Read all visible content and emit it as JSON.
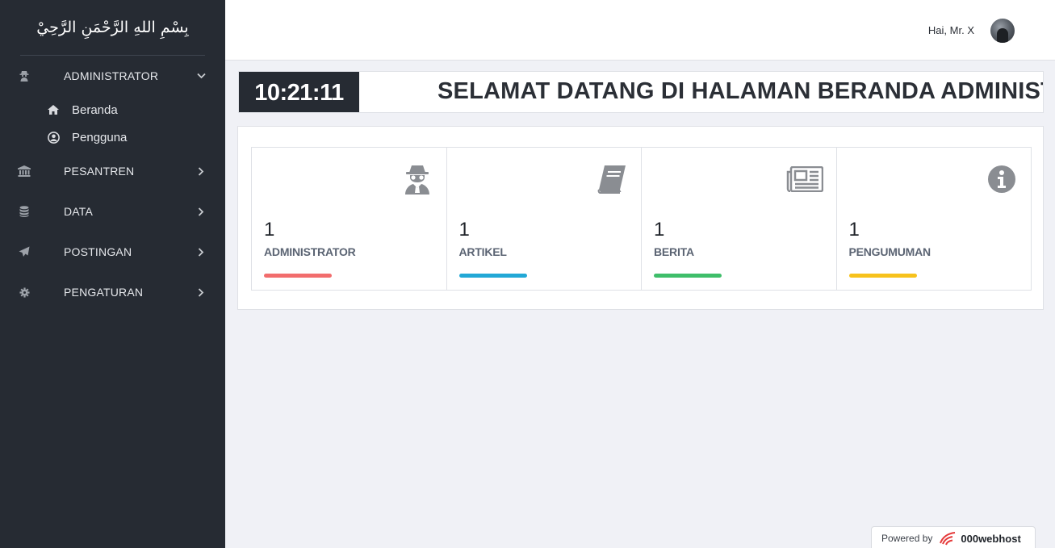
{
  "sidebar": {
    "brand": "بِسْمِ اللهِ الرَّحْمَنِ الرَّحِيْ",
    "items": [
      {
        "label": "ADMINISTRATOR",
        "icon": "user-secret-icon",
        "chevron": "chevron-down-icon"
      },
      {
        "label": "PESANTREN",
        "icon": "institution-icon",
        "chevron": "chevron-right-icon"
      },
      {
        "label": "DATA",
        "icon": "database-icon",
        "chevron": "chevron-right-icon"
      },
      {
        "label": "POSTINGAN",
        "icon": "paper-plane-icon",
        "chevron": "chevron-right-icon"
      },
      {
        "label": "PENGATURAN",
        "icon": "gear-icon",
        "chevron": "chevron-right-icon"
      }
    ],
    "submenu": [
      {
        "label": "Beranda",
        "icon": "home-icon"
      },
      {
        "label": "Pengguna",
        "icon": "user-circle-icon"
      }
    ]
  },
  "topbar": {
    "greeting": "Hai, Mr. X"
  },
  "welcome": {
    "clock": "10:21:11",
    "message": "SELAMAT DATANG DI HALAMAN BERANDA ADMINISTRATOR"
  },
  "stats": [
    {
      "count": "1",
      "label": "ADMINISTRATOR",
      "icon": "user-secret-icon",
      "color": "#f26d6d"
    },
    {
      "count": "1",
      "label": "ARTIKEL",
      "icon": "book-icon",
      "color": "#22a8d6"
    },
    {
      "count": "1",
      "label": "BERITA",
      "icon": "newspaper-icon",
      "color": "#3fbe6a"
    },
    {
      "count": "1",
      "label": "PENGUMUMAN",
      "icon": "info-circle-icon",
      "color": "#f7c21c"
    }
  ],
  "footer": {
    "powered_label": "Powered by",
    "powered_brand": "000webhost"
  },
  "colors": {
    "sidebar_bg": "#262b33",
    "page_bg": "#f0f1f6",
    "icon_gray": "#8a8d92"
  }
}
